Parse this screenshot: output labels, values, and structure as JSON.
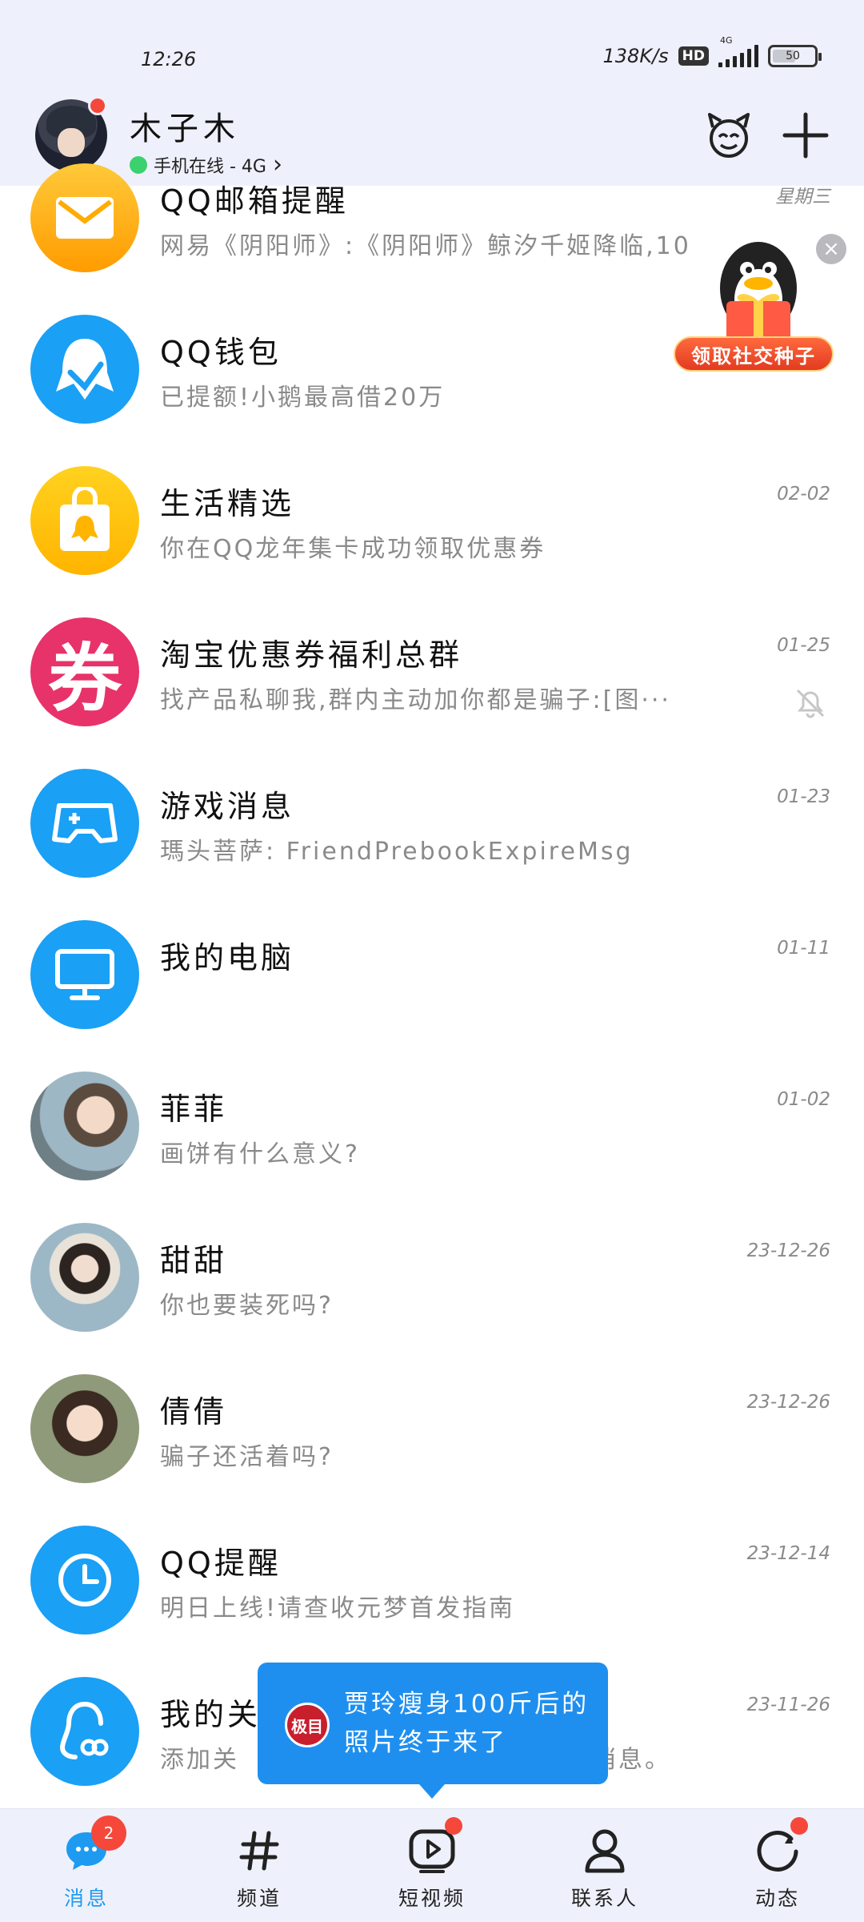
{
  "status_bar": {
    "time": "12:26",
    "speed": "138K/s",
    "hd": "HD",
    "network": "4G",
    "battery": "50"
  },
  "header": {
    "name": "木子木",
    "status": "手机在线 - 4G",
    "chevron": "›"
  },
  "gift": {
    "label": "领取社交种子",
    "close": "×"
  },
  "conversations": [
    {
      "title": "QQ邮箱提醒",
      "preview": "网易《阴阳师》:《阴阳师》鲸汐千姬降临,10",
      "time": "星期三",
      "icon": "mail-icon",
      "color": "#ffb400"
    },
    {
      "title": "QQ钱包",
      "preview": "已提额!小鹅最高借20万",
      "time": "",
      "icon": "penguin-wallet-icon",
      "color": "#1aa0f5"
    },
    {
      "title": "生活精选",
      "preview": "你在QQ龙年集卡成功领取优惠券",
      "time": "02-02",
      "icon": "shopping-bag-icon",
      "color": "#ffc400"
    },
    {
      "title": "淘宝优惠券福利总群",
      "preview": "找产品私聊我,群内主动加你都是骗子:[图···",
      "time": "01-25",
      "icon": "coupon-icon",
      "color": "#e8326a",
      "glyph": "券",
      "muted": true
    },
    {
      "title": "游戏消息",
      "preview": "瑪头菩萨: FriendPrebookExpireMsg",
      "time": "01-23",
      "icon": "gamepad-icon",
      "color": "#1aa0f5"
    },
    {
      "title": "我的电脑",
      "preview": "",
      "time": "01-11",
      "icon": "monitor-icon",
      "color": "#1aa0f5"
    },
    {
      "title": "菲菲",
      "preview": "画饼有什么意义?",
      "time": "01-02",
      "icon": "avatar-photo",
      "color": "#c9a38a"
    },
    {
      "title": "甜甜",
      "preview": "你也要装死吗?",
      "time": "23-12-26",
      "icon": "avatar-photo",
      "color": "#8aa7b8"
    },
    {
      "title": "倩倩",
      "preview": "骗子还活着吗?",
      "time": "23-12-26",
      "icon": "avatar-photo",
      "color": "#b99b86"
    },
    {
      "title": "QQ提醒",
      "preview": "明日上线!请查收元梦首发指南",
      "time": "23-12-14",
      "icon": "clock-icon",
      "color": "#1aa0f5"
    },
    {
      "title": "我的关",
      "preview": "添加关",
      "preview_tail": "消息。",
      "time": "23-11-26",
      "icon": "follow-icon",
      "color": "#1aa0f5"
    }
  ],
  "popup": {
    "logo": "极目",
    "line1": "贾玲瘦身100斤后的",
    "line2": "照片终于来了"
  },
  "tabs": [
    {
      "label": "消息",
      "badge": "2",
      "active": true
    },
    {
      "label": "频道"
    },
    {
      "label": "短视频",
      "dot": true
    },
    {
      "label": "联系人"
    },
    {
      "label": "动态",
      "dot": true
    }
  ],
  "colors": {
    "accent": "#1e9bf0",
    "badge": "#f5483a",
    "header_bg": "#eef1fb"
  }
}
